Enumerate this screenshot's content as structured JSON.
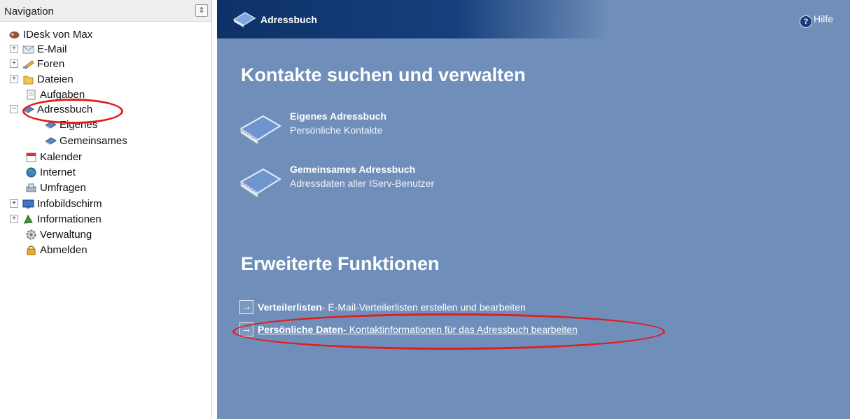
{
  "nav": {
    "title": "Navigation",
    "collapse_glyph": "⇕",
    "items": [
      {
        "label": "IDesk von Max",
        "icon": "idesk-icon"
      },
      {
        "label": "E-Mail",
        "icon": "mail-icon"
      },
      {
        "label": "Foren",
        "icon": "forum-icon"
      },
      {
        "label": "Dateien",
        "icon": "folder-icon"
      },
      {
        "label": "Aufgaben",
        "icon": "tasks-icon"
      },
      {
        "label": "Adressbuch",
        "icon": "addressbook-icon"
      },
      {
        "label": "Eigenes",
        "icon": "addressbook-icon"
      },
      {
        "label": "Gemeinsames",
        "icon": "addressbook-icon"
      },
      {
        "label": "Kalender",
        "icon": "calendar-icon"
      },
      {
        "label": "Internet",
        "icon": "globe-icon"
      },
      {
        "label": "Umfragen",
        "icon": "survey-icon"
      },
      {
        "label": "Infobildschirm",
        "icon": "monitor-icon"
      },
      {
        "label": "Informationen",
        "icon": "info-icon"
      },
      {
        "label": "Verwaltung",
        "icon": "gear-icon"
      },
      {
        "label": "Abmelden",
        "icon": "lock-icon"
      }
    ],
    "expand_plus": "+",
    "expand_minus": "−"
  },
  "header": {
    "title": "Adressbuch",
    "help_label": "Hilfe",
    "help_glyph": "?"
  },
  "main": {
    "section1_title": "Kontakte suchen und verwalten",
    "entries": [
      {
        "title": "Eigenes Adressbuch",
        "subtitle": "Persönliche Kontakte"
      },
      {
        "title": "Gemeinsames Adressbuch",
        "subtitle": "Adressdaten aller IServ-Benutzer"
      }
    ],
    "section2_title": "Erweiterte Funktionen",
    "links": [
      {
        "bold": "Verteilerlisten",
        "rest": " - E-Mail-Verteilerlisten erstellen und bearbeiten"
      },
      {
        "bold": "Persönliche Daten",
        "rest": " - Kontaktinformationen für das Adressbuch bearbeiten"
      }
    ],
    "arrow_glyph": "→"
  },
  "colors": {
    "content_bg": "#6f8fba",
    "header_dark": "#0e3268",
    "annotation": "#e31c1c"
  }
}
